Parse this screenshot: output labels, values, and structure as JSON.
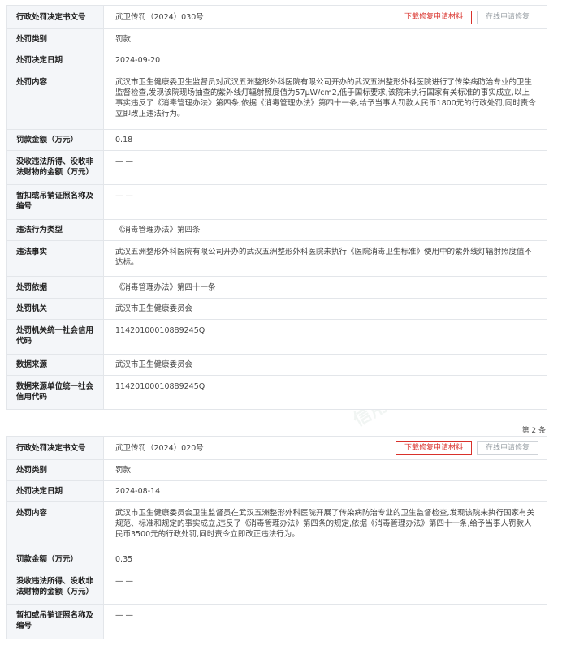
{
  "records": [
    {
      "doc_number_label": "行政处罚决定书文号",
      "doc_number": "武卫传罚（2024）030号",
      "download_btn": "下载修复申请材料",
      "online_btn": "在线申请修复",
      "category_label": "处罚类别",
      "category": "罚款",
      "date_label": "处罚决定日期",
      "date": "2024-09-20",
      "content_label": "处罚内容",
      "content": "武汉市卫生健康委卫生监督员对武汉五洲整形外科医院有限公司开办的武汉五洲整形外科医院进行了传染病防治专业的卫生监督检查,发现该院现场抽查的紫外线灯辐射照度值为57μW/cm2,低于国标要求,该院未执行国家有关标准的事实成立,以上事实违反了《消毒管理办法》第四条,依据《消毒管理办法》第四十一条,给予当事人罚款人民币1800元的行政处罚,同时责令立即改正违法行为。",
      "amount_label": "罚款金额（万元）",
      "amount": "0.18",
      "confiscation_label": "没收违法所得、没收非法财物的金额（万元）",
      "confiscation": "— —",
      "license_label": "暂扣或吊销证照名称及编号",
      "license": "— —",
      "violation_type_label": "违法行为类型",
      "violation_type": "《消毒管理办法》第四条",
      "facts_label": "违法事实",
      "facts": "武汉五洲整形外科医院有限公司开办的武汉五洲整形外科医院未执行《医院消毒卫生标准》使用中的紫外线灯辐射照度值不达标。",
      "basis_label": "处罚依据",
      "basis": "《消毒管理办法》第四十一条",
      "authority_label": "处罚机关",
      "authority": "武汉市卫生健康委员会",
      "authority_code_label": "处罚机关统一社会信用代码",
      "authority_code": "11420100010889245Q",
      "source_label": "数据来源",
      "source": "武汉市卫生健康委员会",
      "source_code_label": "数据来源单位统一社会信用代码",
      "source_code": "11420100010889245Q"
    },
    {
      "doc_number_label": "行政处罚决定书文号",
      "doc_number": "武卫传罚（2024）020号",
      "download_btn": "下载修复申请材料",
      "online_btn": "在线申请修复",
      "category_label": "处罚类别",
      "category": "罚款",
      "date_label": "处罚决定日期",
      "date": "2024-08-14",
      "content_label": "处罚内容",
      "content": "武汉市卫生健康委员会卫生监督员在武汉五洲整形外科医院开展了传染病防治专业的卫生监督检查,发现该院未执行国家有关规范、标准和规定的事实成立,违反了《消毒管理办法》第四条的规定,依据《消毒管理办法》第四十一条,给予当事人罚款人民币3500元的行政处罚,同时责令立即改正违法行为。",
      "amount_label": "罚款金额（万元）",
      "amount": "0.35",
      "confiscation_label": "没收违法所得、没收非法财物的金额（万元）",
      "confiscation": "— —",
      "license_label": "暂扣或吊销证照名称及编号",
      "license": "— —"
    }
  ],
  "count_label": "第 2 条",
  "watermark": "信用中国"
}
